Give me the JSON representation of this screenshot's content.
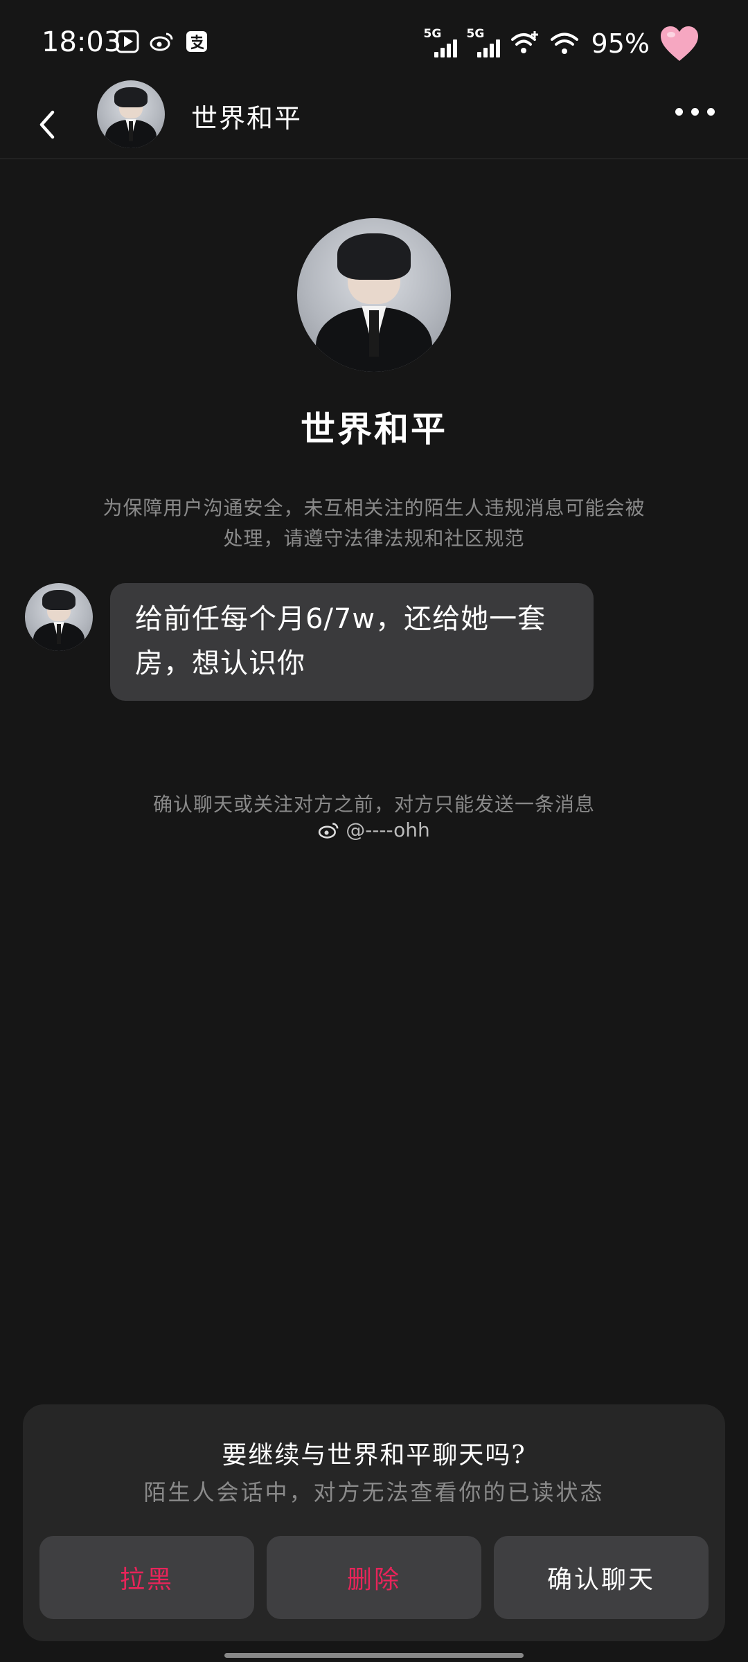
{
  "status_bar": {
    "time": "18:03",
    "signal1_label": "5G",
    "signal2_label": "5G",
    "battery": "95%",
    "app_icons": [
      "play-icon",
      "weibo-icon",
      "alipay-icon"
    ]
  },
  "header": {
    "title": "世界和平"
  },
  "profile": {
    "name": "世界和平",
    "notice": "为保障用户沟通安全，未互相关注的陌生人违规消息可能会被处理，请遵守法律法规和社区规范"
  },
  "message": {
    "text": "给前任每个月6/7w，还给她一套房，想认识你"
  },
  "confirm_note": "确认聊天或关注对方之前，对方只能发送一条消息",
  "watermark": "@----ohh",
  "sheet": {
    "title": "要继续与世界和平聊天吗?",
    "subtitle": "陌生人会话中，对方无法查看你的已读状态",
    "block_label": "拉黑",
    "delete_label": "删除",
    "confirm_label": "确认聊天"
  },
  "colors": {
    "background": "#161616",
    "danger": "#e8245a",
    "bubble": "#3a3a3c"
  }
}
